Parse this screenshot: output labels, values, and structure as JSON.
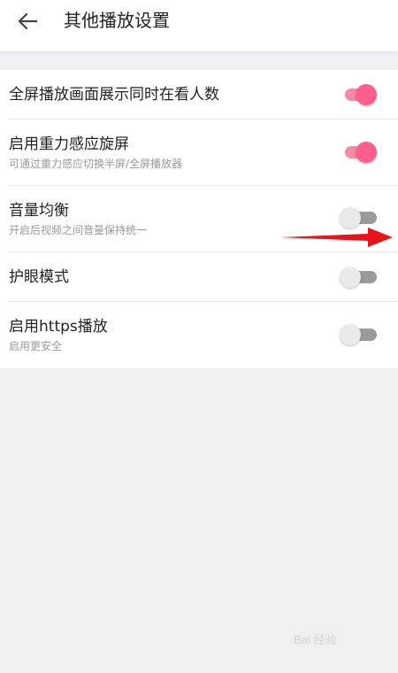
{
  "header": {
    "title": "其他播放设置",
    "back_icon": "arrow-left-icon"
  },
  "settings": [
    {
      "title": "全屏播放画面展示同时在看人数",
      "subtitle": "",
      "enabled": true
    },
    {
      "title": "启用重力感应旋屏",
      "subtitle": "可通过重力感应切换半屏/全屏播放器",
      "enabled": true
    },
    {
      "title": "音量均衡",
      "subtitle": "开启后视频之间音量保持统一",
      "enabled": false
    },
    {
      "title": "护眼模式",
      "subtitle": "",
      "enabled": false
    },
    {
      "title": "启用https播放",
      "subtitle": "启用更安全",
      "enabled": false
    }
  ],
  "watermark": "Bai 经验",
  "colors": {
    "toggle_on": "#ff5f8e",
    "toggle_on_track": "#f48aa6",
    "toggle_off_track": "#9a9a9a",
    "arrow": "#e8141b"
  }
}
